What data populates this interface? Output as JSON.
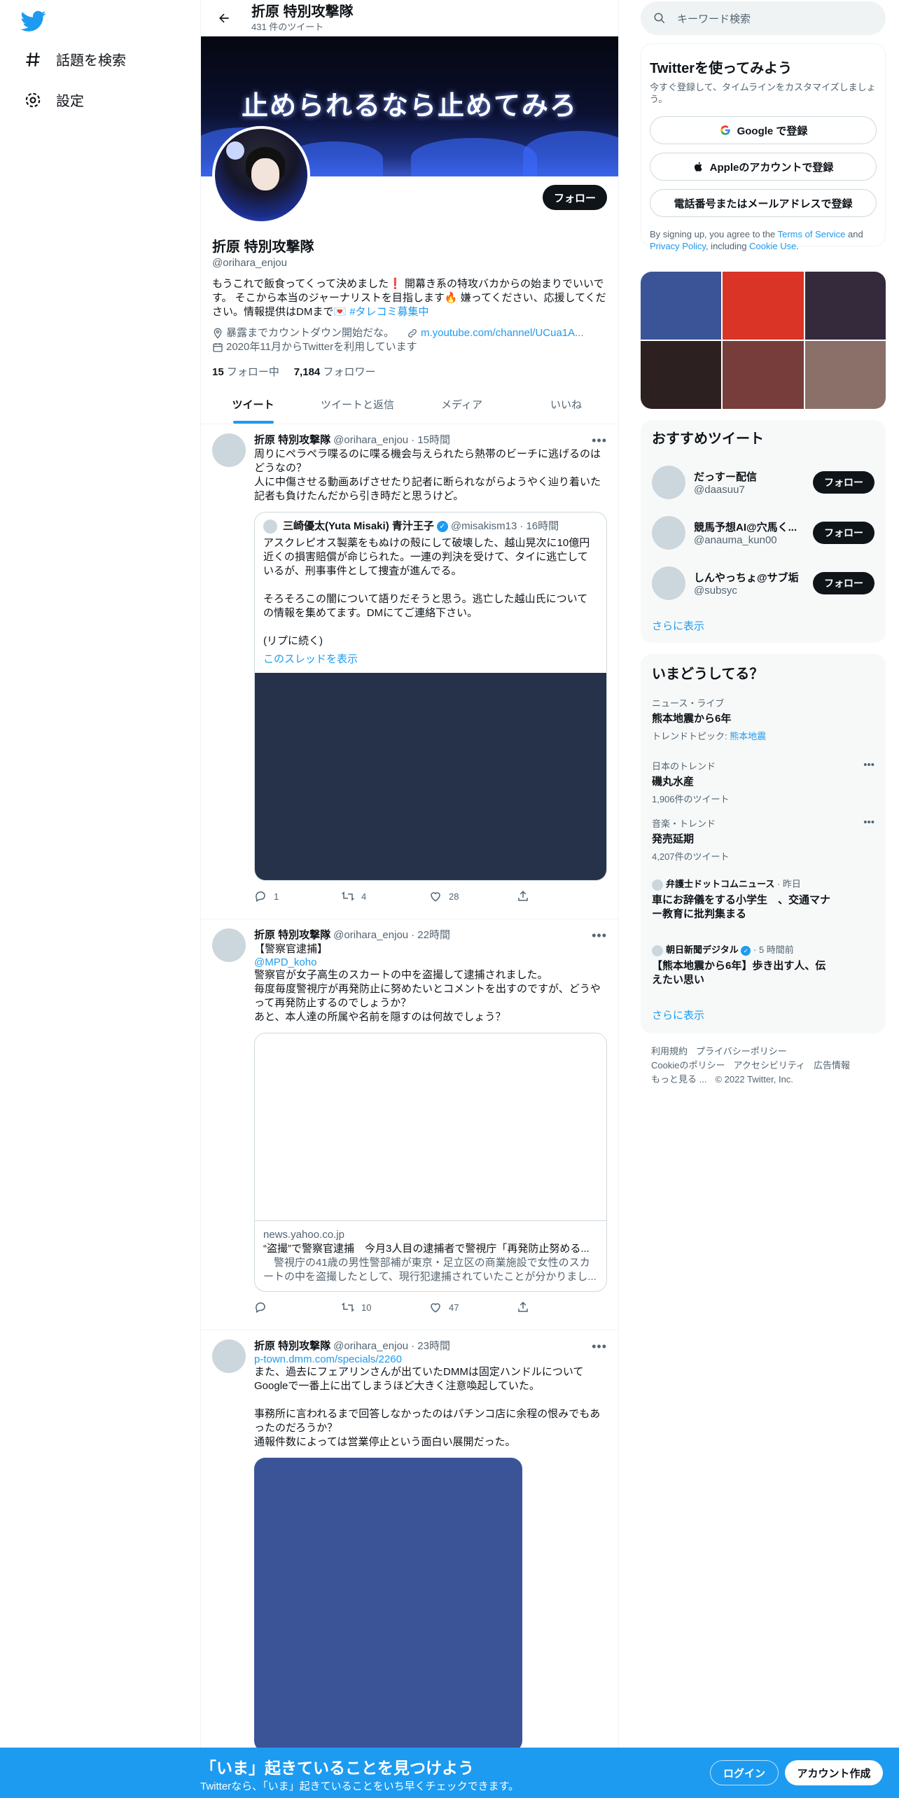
{
  "nav": {
    "explore": "話題を検索",
    "settings": "設定"
  },
  "header": {
    "name": "折原 特別攻撃隊",
    "tweet_count": "431 件のツイート"
  },
  "banner_text": "止められるなら止めてみろ",
  "profile": {
    "follow_label": "フォロー",
    "name": "折原 特別攻撃隊",
    "handle": "@orihara_enjou",
    "bio_1": "もうこれで飯食ってくって決めました❗️ 開幕き系の特攻バカからの始まりでいいです。 そこから本当のジャーナリストを目指します🔥 嫌ってください、応援してください。情報提供はDMまで💌 ",
    "bio_hashtag": "#タレコミ募集中",
    "location": "暴露までカウントダウン開始だな。",
    "url": "m.youtube.com/channel/UCua1A...",
    "joined": "2020年11月からTwitterを利用しています",
    "following_count": "15",
    "following_label": "フォロー中",
    "followers_count": "7,184",
    "followers_label": "フォロワー"
  },
  "tabs": [
    "ツイート",
    "ツイートと返信",
    "メディア",
    "いいね"
  ],
  "tweets": [
    {
      "name": "折原 特別攻撃隊",
      "handle": "@orihara_enjou",
      "time": "· 15時間",
      "text": "周りにペラペラ喋るのに喋る機会与えられたら熱帯のビーチに逃げるのはどうなの？\n人に中傷させる動画あげさせたり記者に断られながらようやく辿り着いた記者も負けたんだから引き時だと思うけど。",
      "quote": {
        "name": "三崎優太(Yuta Misaki) 青汁王子",
        "handle": "@misakism13",
        "time": "· 16時間",
        "text": "アスクレピオス製薬をもぬけの殻にして破壊した、越山晃次に10億円近くの損害賠償が命じられた。一連の判決を受けて、タイに逃亡しているが、刑事事件として捜査が進んでる。\n\nそろそろこの闇について語りだそうと思う。逃亡した越山氏についての情報を集めてます。DMにてご連絡下さい。\n\n(リプに続く)",
        "thread_link": "このスレッドを表示"
      },
      "replies": "1",
      "retweets": "4",
      "likes": "28"
    },
    {
      "name": "折原 特別攻撃隊",
      "handle": "@orihara_enjou",
      "time": "· 22時間",
      "text_1": "【警察官逮捕】",
      "mention": "@MPD_koho",
      "text_2": "警察官が女子高生のスカートの中を盗撮して逮捕されました。\n毎度毎度警視庁が再発防止に努めたいとコメントを出すのですが、どうやって再発防止するのでしょうか？\nあと、本人達の所属や名前を隠すのは何故でしょう？",
      "card": {
        "domain": "news.yahoo.co.jp",
        "title": "“盗撮”で警察官逮捕　今月3人目の逮捕者で警視庁「再発防止努める...",
        "desc": "　警視庁の41歳の男性警部補が東京・足立区の商業施設で女性のスカートの中を盗撮したとして、現行犯逮捕されていたことが分かりまし..."
      },
      "replies": "",
      "retweets": "10",
      "likes": "47"
    },
    {
      "name": "折原 特別攻撃隊",
      "handle": "@orihara_enjou",
      "time": "· 23時間",
      "link": "p-town.dmm.com/specials/2260",
      "text": "また、過去にフェアリンさんが出ていたDMMは固定ハンドルについてGoogleで一番上に出てしまうほど大きく注意喚起していた。\n\n事務所に言われるまで回答しなかったのはパチンコ店に余程の恨みでもあったのだろうか？\n通報件数によっては営業停止という面白い展開だった。"
    }
  ],
  "search": {
    "placeholder": "キーワード検索"
  },
  "signup": {
    "title": "Twitterを使ってみよう",
    "desc": "今すぐ登録して、タイムラインをカスタマイズしましょう。",
    "google": "Google で登録",
    "apple": "Appleのアカウントで登録",
    "phone": "電話番号またはメールアドレスで登録",
    "legal_1": "By signing up, you agree to the ",
    "tos": "Terms of Service",
    "legal_2": " and ",
    "privacy": "Privacy Policy",
    "legal_3": ", including ",
    "cookie": "Cookie Use",
    "legal_4": "."
  },
  "recommend": {
    "title": "おすすめツイート",
    "users": [
      {
        "name": "だっすー配信",
        "handle": "@daasuu7",
        "btn": "フォロー"
      },
      {
        "name": "競馬予想AI@穴馬く...",
        "handle": "@anauma_kun00",
        "btn": "フォロー"
      },
      {
        "name": "しんやっちょ@サブ垢",
        "handle": "@subsyc",
        "btn": "フォロー"
      }
    ],
    "more": "さらに表示"
  },
  "trends": {
    "title": "いまどうしてる？",
    "items": [
      {
        "cat": "ニュース・ライブ",
        "title": "熊本地震から6年",
        "sub_prefix": "トレンドトピック: ",
        "sub_link": "熊本地震"
      },
      {
        "cat": "日本のトレンド",
        "title": "磯丸水産",
        "count": "1,906件のツイート"
      },
      {
        "cat": "音楽・トレンド",
        "title": "発売延期",
        "count": "4,207件のツイート"
      },
      {
        "source": "弁護士ドットコムニュース",
        "time": "· 昨日",
        "title": "車にお辞儀をする小学生　、交通マナー教育に批判集まる"
      },
      {
        "source": "朝日新聞デジタル",
        "time": "· 5 時間前",
        "title": "【熊本地震から6年】歩き出す人、伝えたい思い"
      }
    ],
    "more": "さらに表示"
  },
  "footer": {
    "links": [
      "利用規約",
      "プライバシーポリシー",
      "Cookieのポリシー",
      "アクセシビリティ",
      "広告情報",
      "もっと見る ..."
    ],
    "copyright": "© 2022 Twitter, Inc."
  },
  "bottom": {
    "title": "「いま」起きていることを見つけよう",
    "sub": "Twitterなら、「いま」起きていることをいち早くチェックできます。",
    "login": "ログイン",
    "signup": "アカウント作成"
  },
  "colors": {
    "accent": "#1d9bf0",
    "media_grid": [
      "#3a5497",
      "#d93426",
      "#352a3b",
      "#2c2020",
      "#763d3b",
      "#8a7068"
    ],
    "quote_media": "#253249",
    "tweet3_media": "#3a5497"
  }
}
